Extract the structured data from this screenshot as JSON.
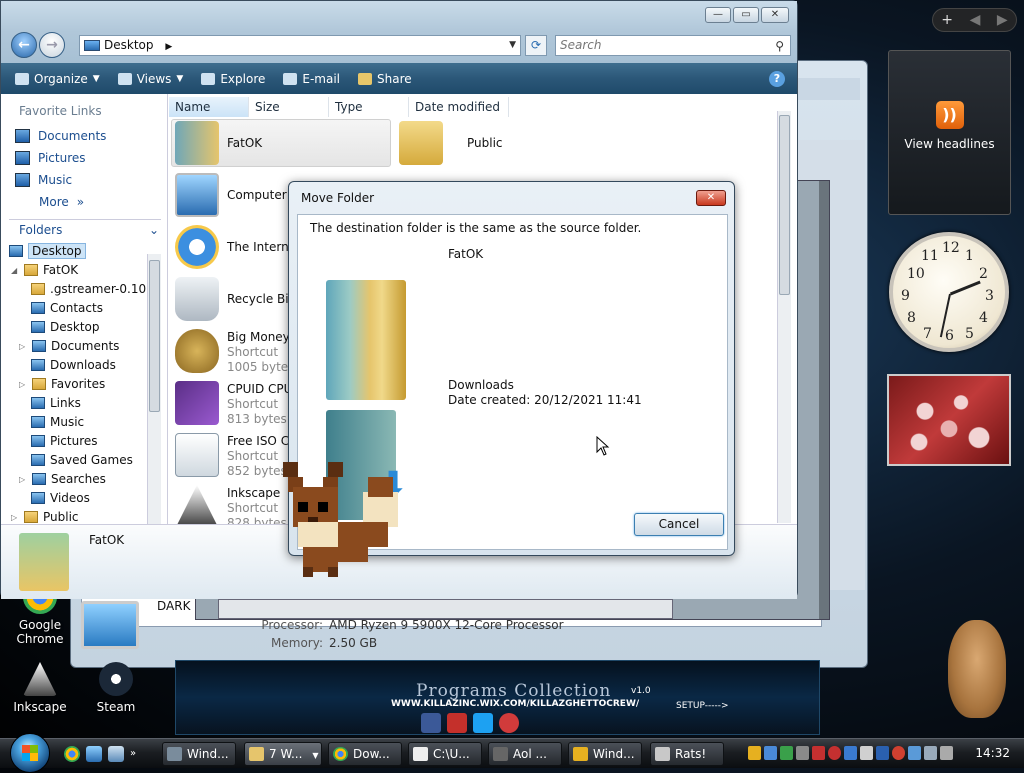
{
  "explorer": {
    "address": "Desktop",
    "search_placeholder": "Search",
    "toolbar": {
      "organize": "Organize",
      "views": "Views",
      "explore": "Explore",
      "email": "E-mail",
      "share": "Share",
      "help": "?"
    },
    "favorite_links_header": "Favorite Links",
    "favorite_links": [
      "Documents",
      "Pictures",
      "Music",
      "More"
    ],
    "folders_header": "Folders",
    "tree": [
      "Desktop",
      "FatOK",
      ".gstreamer-0.10",
      "Contacts",
      "Desktop",
      "Documents",
      "Downloads",
      "Favorites",
      "Links",
      "Music",
      "Pictures",
      "Saved Games",
      "Searches",
      "Videos",
      "Public"
    ],
    "columns": [
      "Name",
      "Size",
      "Type",
      "Date modified"
    ],
    "files": [
      {
        "name": "FatOK",
        "sub1": "",
        "sub2": ""
      },
      {
        "name": "Public",
        "sub1": "",
        "sub2": ""
      },
      {
        "name": "Computer",
        "sub1": "",
        "sub2": ""
      },
      {
        "name": "The Interne",
        "sub1": "",
        "sub2": ""
      },
      {
        "name": "Recycle Bin",
        "sub1": "",
        "sub2": ""
      },
      {
        "name": "Big Money",
        "sub1": "Shortcut",
        "sub2": "1005 bytes"
      },
      {
        "name": "CPUID CPU",
        "sub1": "Shortcut",
        "sub2": "813 bytes"
      },
      {
        "name": "Free ISO Cre",
        "sub1": "Shortcut",
        "sub2": "852 bytes"
      },
      {
        "name": "Inkscape",
        "sub1": "Shortcut",
        "sub2": "828 bytes"
      }
    ],
    "detail_name": "FatOK"
  },
  "background_window": {
    "dark_label": "DARK",
    "processor_label": "Processor:",
    "processor_value": "AMD Ryzen 9 5900X 12-Core Processor",
    "memory_label": "Memory:",
    "memory_value": "2.50 GB"
  },
  "dialog": {
    "title": "Move Folder",
    "message": "The destination folder is the same as the source folder.",
    "source_name": "FatOK",
    "dest_name": "Downloads",
    "dest_date": "Date created: 20/12/2021 11:41",
    "cancel": "Cancel"
  },
  "banner": {
    "title": "Programs Collection",
    "url": "WWW.KILLAZINC.WIX.COM/KILLAZGHETTOCREW/",
    "setup": "SETUP----->",
    "version": "v1.0"
  },
  "gadgets": {
    "feed_label": "View headlines"
  },
  "desktop_icons": [
    "Google Chrome",
    "Inkscape",
    "Steam"
  ],
  "taskbar": {
    "tasks": [
      "Wind...",
      "7 W...",
      "Dow...",
      "C:\\U...",
      "Aol ...",
      "Wind...",
      "Rats!"
    ],
    "clock": "14:32"
  },
  "colors": {
    "toolbar": "#2b5778",
    "accent": "#1c4e8f",
    "close": "#c8381e"
  }
}
